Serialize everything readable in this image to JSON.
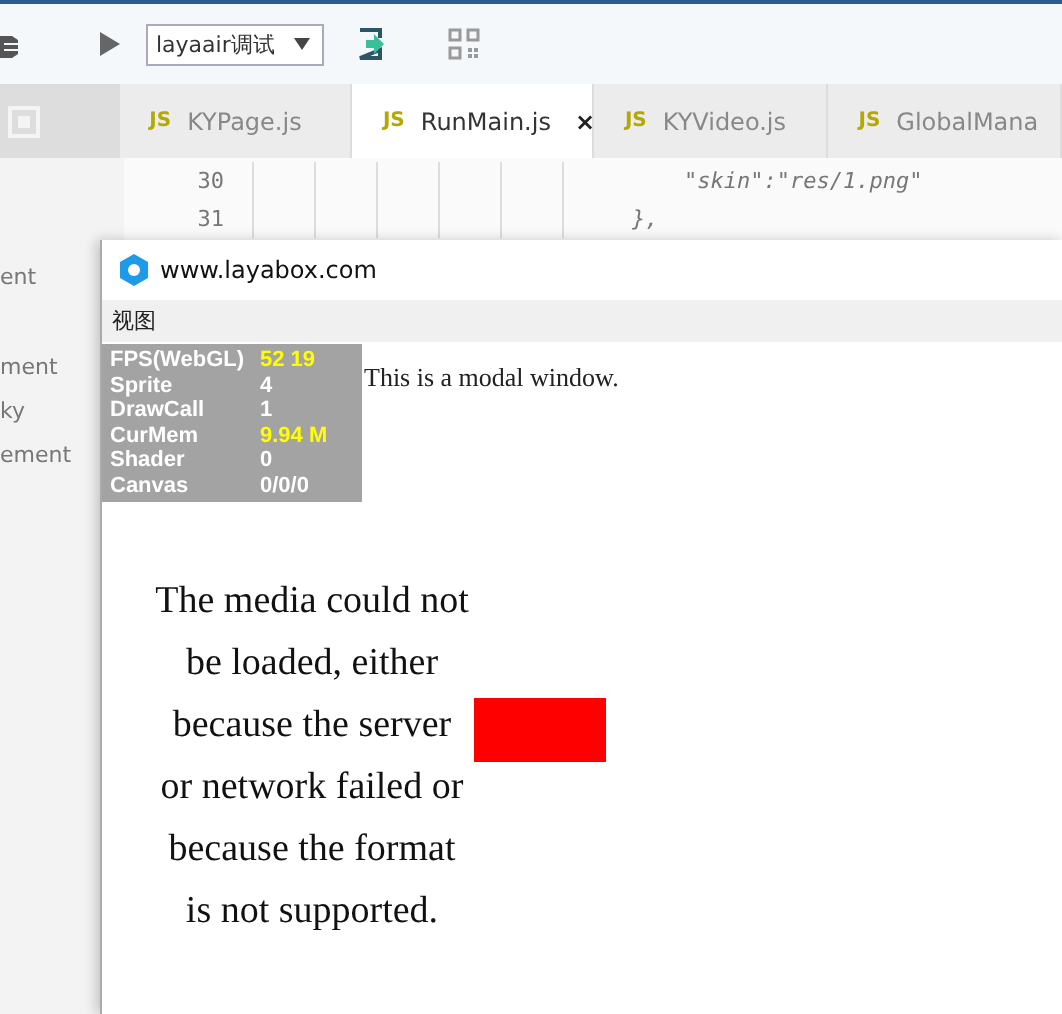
{
  "toolbar": {
    "config_select": {
      "value": "layaair调试"
    }
  },
  "tabs": [
    {
      "badge": "JS",
      "label": "KYPage.js",
      "selected": false
    },
    {
      "badge": "JS",
      "label": "RunMain.js",
      "selected": true,
      "close": "×"
    },
    {
      "badge": "JS",
      "label": "KYVideo.js",
      "selected": false
    },
    {
      "badge": "JS",
      "label": "GlobalMana",
      "selected": false
    }
  ],
  "sidebar": {
    "items": [
      {
        "label": "ent"
      },
      {
        "label": "ment"
      },
      {
        "label": "ky"
      },
      {
        "label": "ement"
      }
    ]
  },
  "editor": {
    "lines": [
      {
        "number": "30",
        "code": "\"skin\":\"res/1.png\""
      },
      {
        "number": "31",
        "code": "},"
      }
    ]
  },
  "preview": {
    "title": "www.layabox.com",
    "menu": [
      "视图"
    ],
    "stats": [
      {
        "label": "FPS(WebGL)",
        "value": "52 19",
        "highlight": true
      },
      {
        "label": "Sprite",
        "value": "4",
        "highlight": false
      },
      {
        "label": "DrawCall",
        "value": "1",
        "highlight": false
      },
      {
        "label": "CurMem",
        "value": "9.94 M",
        "highlight": true
      },
      {
        "label": "Shader",
        "value": "0",
        "highlight": false
      },
      {
        "label": "Canvas",
        "value": "0/0/0",
        "highlight": false
      }
    ],
    "modal_note": "This is a modal window.",
    "error_message": "The media could not be loaded, either because the server or network failed or because the format is not supported."
  }
}
